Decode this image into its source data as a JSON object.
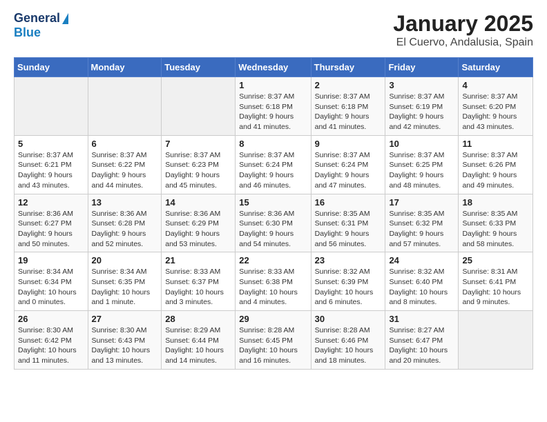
{
  "header": {
    "logo_general": "General",
    "logo_blue": "Blue",
    "title": "January 2025",
    "subtitle": "El Cuervo, Andalusia, Spain"
  },
  "days_of_week": [
    "Sunday",
    "Monday",
    "Tuesday",
    "Wednesday",
    "Thursday",
    "Friday",
    "Saturday"
  ],
  "weeks": [
    [
      {
        "day": "",
        "info": ""
      },
      {
        "day": "",
        "info": ""
      },
      {
        "day": "",
        "info": ""
      },
      {
        "day": "1",
        "info": "Sunrise: 8:37 AM\nSunset: 6:18 PM\nDaylight: 9 hours and 41 minutes."
      },
      {
        "day": "2",
        "info": "Sunrise: 8:37 AM\nSunset: 6:18 PM\nDaylight: 9 hours and 41 minutes."
      },
      {
        "day": "3",
        "info": "Sunrise: 8:37 AM\nSunset: 6:19 PM\nDaylight: 9 hours and 42 minutes."
      },
      {
        "day": "4",
        "info": "Sunrise: 8:37 AM\nSunset: 6:20 PM\nDaylight: 9 hours and 43 minutes."
      }
    ],
    [
      {
        "day": "5",
        "info": "Sunrise: 8:37 AM\nSunset: 6:21 PM\nDaylight: 9 hours and 43 minutes."
      },
      {
        "day": "6",
        "info": "Sunrise: 8:37 AM\nSunset: 6:22 PM\nDaylight: 9 hours and 44 minutes."
      },
      {
        "day": "7",
        "info": "Sunrise: 8:37 AM\nSunset: 6:23 PM\nDaylight: 9 hours and 45 minutes."
      },
      {
        "day": "8",
        "info": "Sunrise: 8:37 AM\nSunset: 6:24 PM\nDaylight: 9 hours and 46 minutes."
      },
      {
        "day": "9",
        "info": "Sunrise: 8:37 AM\nSunset: 6:24 PM\nDaylight: 9 hours and 47 minutes."
      },
      {
        "day": "10",
        "info": "Sunrise: 8:37 AM\nSunset: 6:25 PM\nDaylight: 9 hours and 48 minutes."
      },
      {
        "day": "11",
        "info": "Sunrise: 8:37 AM\nSunset: 6:26 PM\nDaylight: 9 hours and 49 minutes."
      }
    ],
    [
      {
        "day": "12",
        "info": "Sunrise: 8:36 AM\nSunset: 6:27 PM\nDaylight: 9 hours and 50 minutes."
      },
      {
        "day": "13",
        "info": "Sunrise: 8:36 AM\nSunset: 6:28 PM\nDaylight: 9 hours and 52 minutes."
      },
      {
        "day": "14",
        "info": "Sunrise: 8:36 AM\nSunset: 6:29 PM\nDaylight: 9 hours and 53 minutes."
      },
      {
        "day": "15",
        "info": "Sunrise: 8:36 AM\nSunset: 6:30 PM\nDaylight: 9 hours and 54 minutes."
      },
      {
        "day": "16",
        "info": "Sunrise: 8:35 AM\nSunset: 6:31 PM\nDaylight: 9 hours and 56 minutes."
      },
      {
        "day": "17",
        "info": "Sunrise: 8:35 AM\nSunset: 6:32 PM\nDaylight: 9 hours and 57 minutes."
      },
      {
        "day": "18",
        "info": "Sunrise: 8:35 AM\nSunset: 6:33 PM\nDaylight: 9 hours and 58 minutes."
      }
    ],
    [
      {
        "day": "19",
        "info": "Sunrise: 8:34 AM\nSunset: 6:34 PM\nDaylight: 10 hours and 0 minutes."
      },
      {
        "day": "20",
        "info": "Sunrise: 8:34 AM\nSunset: 6:35 PM\nDaylight: 10 hours and 1 minute."
      },
      {
        "day": "21",
        "info": "Sunrise: 8:33 AM\nSunset: 6:37 PM\nDaylight: 10 hours and 3 minutes."
      },
      {
        "day": "22",
        "info": "Sunrise: 8:33 AM\nSunset: 6:38 PM\nDaylight: 10 hours and 4 minutes."
      },
      {
        "day": "23",
        "info": "Sunrise: 8:32 AM\nSunset: 6:39 PM\nDaylight: 10 hours and 6 minutes."
      },
      {
        "day": "24",
        "info": "Sunrise: 8:32 AM\nSunset: 6:40 PM\nDaylight: 10 hours and 8 minutes."
      },
      {
        "day": "25",
        "info": "Sunrise: 8:31 AM\nSunset: 6:41 PM\nDaylight: 10 hours and 9 minutes."
      }
    ],
    [
      {
        "day": "26",
        "info": "Sunrise: 8:30 AM\nSunset: 6:42 PM\nDaylight: 10 hours and 11 minutes."
      },
      {
        "day": "27",
        "info": "Sunrise: 8:30 AM\nSunset: 6:43 PM\nDaylight: 10 hours and 13 minutes."
      },
      {
        "day": "28",
        "info": "Sunrise: 8:29 AM\nSunset: 6:44 PM\nDaylight: 10 hours and 14 minutes."
      },
      {
        "day": "29",
        "info": "Sunrise: 8:28 AM\nSunset: 6:45 PM\nDaylight: 10 hours and 16 minutes."
      },
      {
        "day": "30",
        "info": "Sunrise: 8:28 AM\nSunset: 6:46 PM\nDaylight: 10 hours and 18 minutes."
      },
      {
        "day": "31",
        "info": "Sunrise: 8:27 AM\nSunset: 6:47 PM\nDaylight: 10 hours and 20 minutes."
      },
      {
        "day": "",
        "info": ""
      }
    ]
  ]
}
